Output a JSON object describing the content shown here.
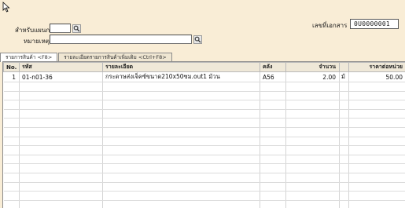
{
  "header": {
    "department_label": "สำหรับแผนก",
    "department_value": "",
    "remark_label": "หมายเหตุ",
    "remark_value": "",
    "docno_label": "เลขที่เอกสาร",
    "docno_value": "0U0000001"
  },
  "tabs": [
    {
      "label": "รายการสินค้า <F8>"
    },
    {
      "label": "รายละเอียดรายการสินค้าเพิ่มเติม <Ctrl+F8>"
    }
  ],
  "grid": {
    "columns": [
      "No.",
      "รหัส",
      "รายละเอียด",
      "คลัง",
      "จำนวน",
      "",
      "ราคาต่อหน่วย"
    ],
    "rows": [
      {
        "no": "1",
        "code": "01-n01-36",
        "desc": "กระดาษส่งเจ็คซ์ขนาด210x50ซม.out1 ม้วน",
        "wh": "A56",
        "qty": "2.00",
        "unit": "ม้",
        "price": "50.00"
      }
    ]
  },
  "colors": {
    "background": "#f9edd6",
    "grid_bg": "#ffffff",
    "header_bg": "#efe8d8"
  },
  "icons": [
    "cursor-arrow-icon",
    "search-icon"
  ]
}
